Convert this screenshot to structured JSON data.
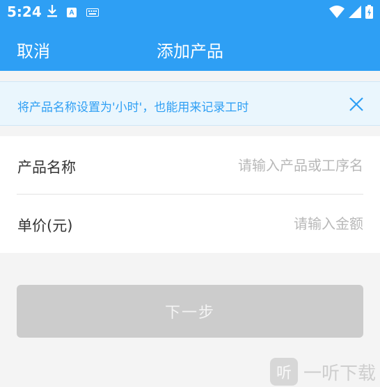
{
  "status_bar": {
    "time": "5:24",
    "icons_left": [
      "download-icon",
      "text-a-icon",
      "keyboard-icon"
    ],
    "icons_right": [
      "wifi-icon",
      "signal-icon",
      "battery-charging-icon"
    ],
    "a_glyph": "A"
  },
  "app_bar": {
    "cancel_label": "取消",
    "title": "添加产品",
    "background": "#2e9ff4"
  },
  "notice": {
    "text": "将产品名称设置为'小时'，也能用来记录工时",
    "color": "#2e9ff4"
  },
  "form": {
    "product_name": {
      "label": "产品名称",
      "value": "",
      "placeholder": "请输入产品或工序名"
    },
    "unit_price": {
      "label": "单价(元)",
      "value": "",
      "placeholder": "请输入金额"
    }
  },
  "next_button": {
    "label": "下一步",
    "enabled": false
  },
  "watermark": {
    "logo_char": "听",
    "text": "一听下载"
  }
}
